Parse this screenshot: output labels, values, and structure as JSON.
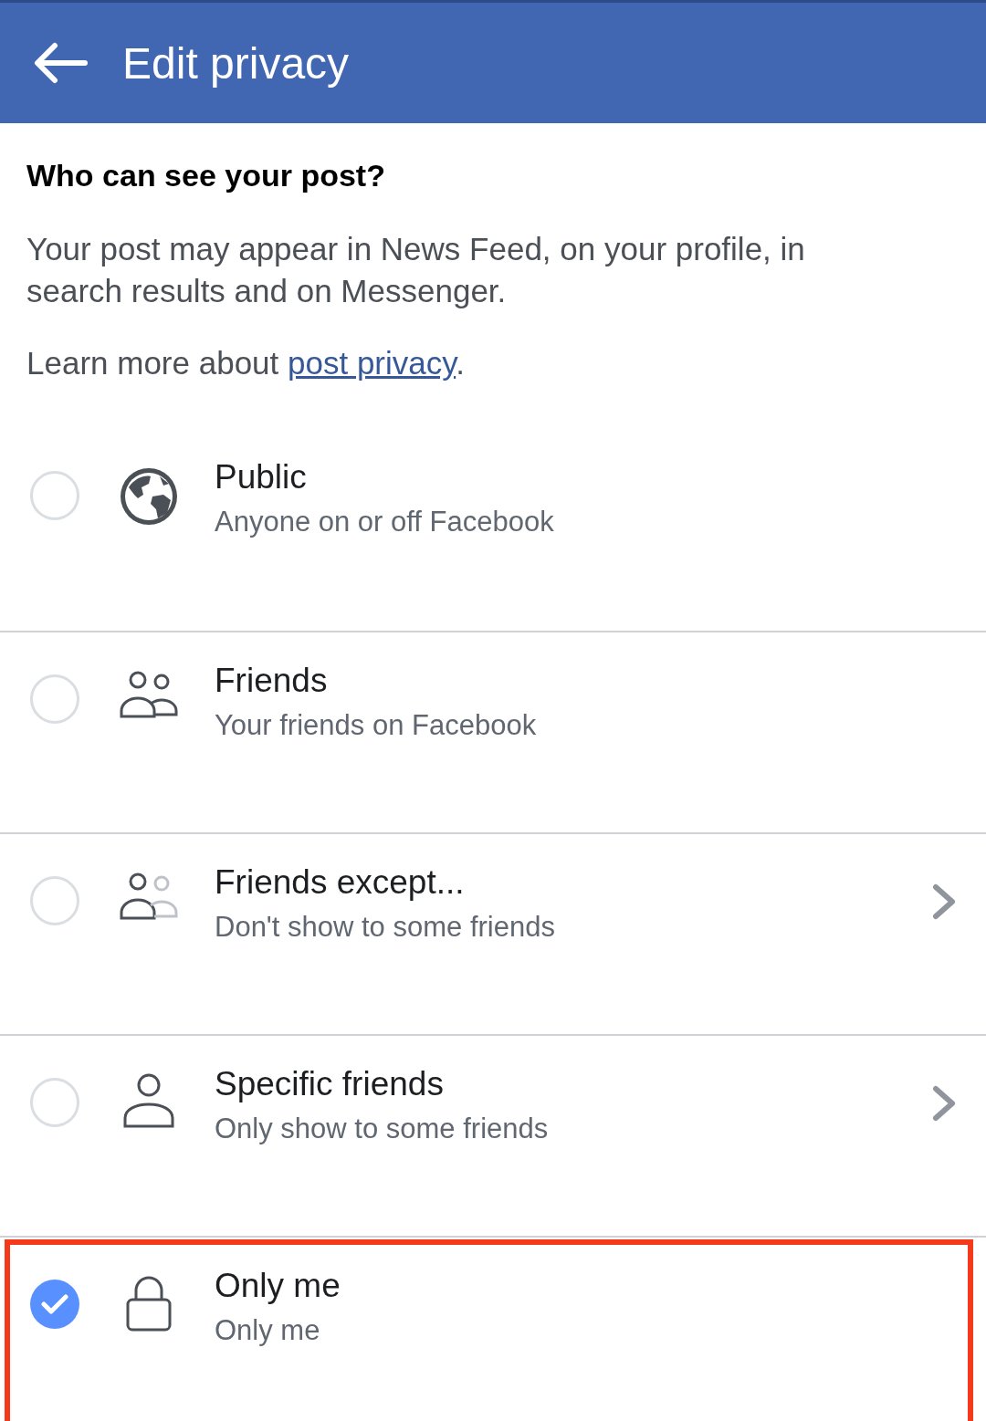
{
  "header": {
    "title": "Edit privacy"
  },
  "heading": "Who can see your post?",
  "description": "Your post may appear in News Feed, on your profile, in search results and on Messenger.",
  "learn_more": {
    "text": "Learn more about ",
    "link": "post privacy",
    "end": "."
  },
  "options": [
    {
      "kind": "globe",
      "title": "Public",
      "subtitle": "Anyone on or off Facebook",
      "selected": false,
      "chevron": false,
      "highlighted": false
    },
    {
      "kind": "friends",
      "title": "Friends",
      "subtitle": "Your friends on Facebook",
      "selected": false,
      "chevron": false,
      "highlighted": false
    },
    {
      "kind": "friends-except",
      "title": "Friends except...",
      "subtitle": "Don't show to some friends",
      "selected": false,
      "chevron": true,
      "highlighted": false
    },
    {
      "kind": "person",
      "title": "Specific friends",
      "subtitle": "Only show to some friends",
      "selected": false,
      "chevron": true,
      "highlighted": false
    },
    {
      "kind": "lock",
      "title": "Only me",
      "subtitle": "Only me",
      "selected": true,
      "chevron": false,
      "highlighted": true
    }
  ]
}
